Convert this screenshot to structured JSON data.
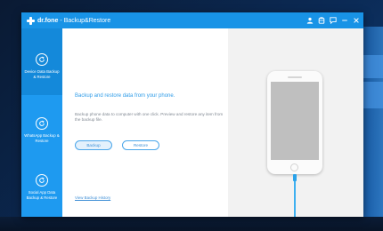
{
  "window": {
    "brand": "dr.fone",
    "separator": "-",
    "title": "Backup&Restore",
    "accent_color": "#1893e6",
    "title_icons": [
      "user-icon",
      "cart-icon",
      "feedback-icon",
      "minimize-icon",
      "close-icon"
    ]
  },
  "sidebar": {
    "items": [
      {
        "label": "Device Data Backup & Restore",
        "icon": "refresh-icon",
        "active": true
      },
      {
        "label": "WhatsApp Backup & Restore",
        "icon": "refresh-icon",
        "active": false
      },
      {
        "label": "Social App Data Backup & Restore",
        "icon": "refresh-icon",
        "active": false
      }
    ]
  },
  "main": {
    "heading": "Backup and restore data from your phone.",
    "description": "Backup phone data to computer with one click. Preview and restore any item from the backup file.",
    "backup_label": "Backup",
    "restore_label": "Restore",
    "history_link": "View Backup History"
  },
  "device": {
    "icon": "phone-icon",
    "cable_color": "#2aa3ea"
  }
}
